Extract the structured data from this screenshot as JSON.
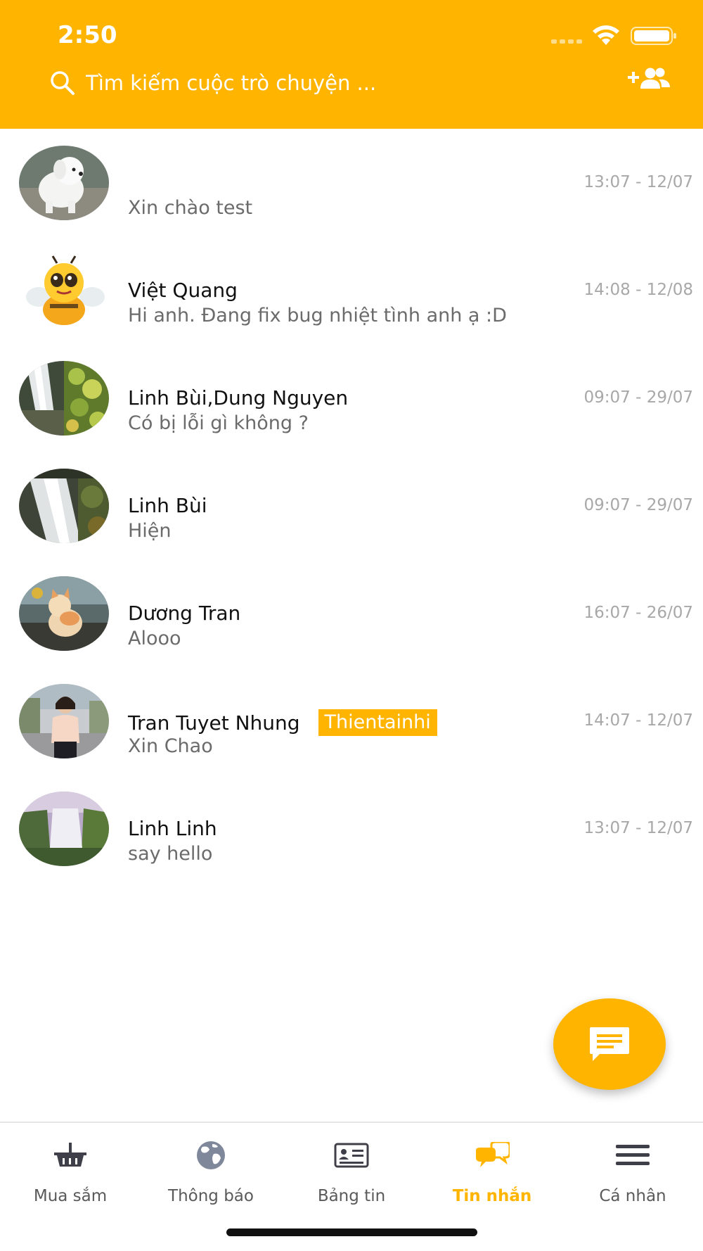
{
  "status_bar": {
    "time": "2:50"
  },
  "header": {
    "search_placeholder": "Tìm kiếm cuộc trò chuyện ...",
    "accent_color": "#FFB400"
  },
  "conversations": [
    {
      "name": "",
      "tag": "",
      "preview": "Xin chào test",
      "time": "13:07 - 12/07",
      "avatar_icon": "white-dog-photo"
    },
    {
      "name": "Việt Quang",
      "tag": "",
      "preview": "Hi anh. Đang fix bug nhiệt tình anh ạ :D",
      "time": "14:08 - 12/08",
      "avatar_icon": "bee-cartoon"
    },
    {
      "name": "Linh Bùi,Dung Nguyen",
      "tag": "",
      "preview": "Có bị lỗi gì không ?",
      "time": "09:07 - 29/07",
      "avatar_icon": "group-waterfall-leaves"
    },
    {
      "name": "Linh Bùi",
      "tag": "",
      "preview": "Hiện",
      "time": "09:07 - 29/07",
      "avatar_icon": "waterfall-photo"
    },
    {
      "name": "Dương Tran",
      "tag": "",
      "preview": "Alooo",
      "time": "16:07 - 26/07",
      "avatar_icon": "kitten-photo"
    },
    {
      "name": "Tran Tuyet Nhung",
      "tag": "Thientainhi",
      "preview": "Xin Chao",
      "time": "14:07 - 12/07",
      "avatar_icon": "woman-portrait"
    },
    {
      "name": "Linh Linh",
      "tag": "",
      "preview": "say hello",
      "time": "13:07 - 12/07",
      "avatar_icon": "misty-waterfall"
    }
  ],
  "fab": {
    "icon": "new-message-icon"
  },
  "tabs": [
    {
      "label": "Mua sắm",
      "icon": "basket-icon",
      "active": false
    },
    {
      "label": "Thông báo",
      "icon": "globe-icon",
      "active": false
    },
    {
      "label": "Bảng tin",
      "icon": "id-card-icon",
      "active": false
    },
    {
      "label": "Tin nhắn",
      "icon": "chat-bubbles-icon",
      "active": true
    },
    {
      "label": "Cá nhân",
      "icon": "menu-icon",
      "active": false
    }
  ]
}
